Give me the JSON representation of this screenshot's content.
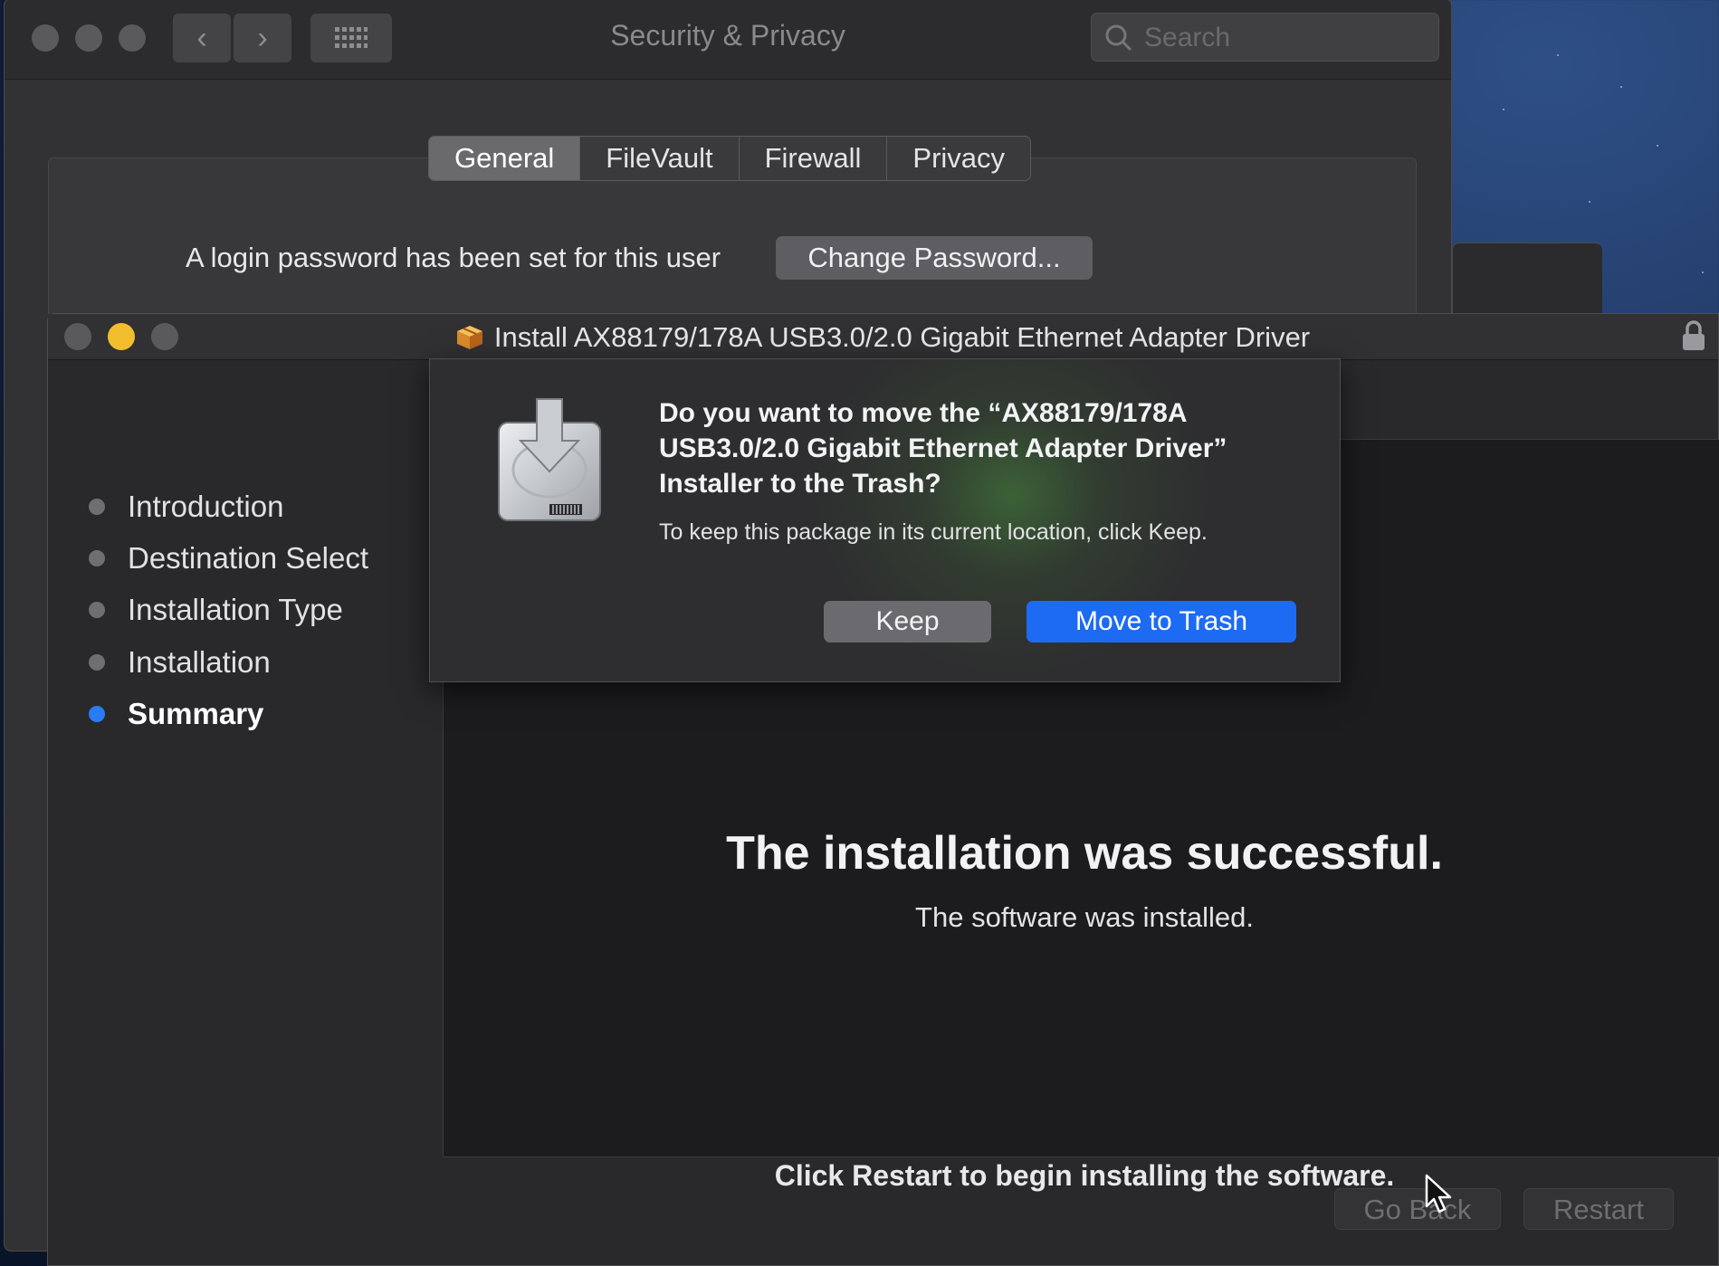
{
  "security_window": {
    "title": "Security & Privacy",
    "search_placeholder": "Search",
    "tabs": [
      {
        "label": "General",
        "active": true
      },
      {
        "label": "FileVault",
        "active": false
      },
      {
        "label": "Firewall",
        "active": false
      },
      {
        "label": "Privacy",
        "active": false
      }
    ],
    "login_text": "A login password has been set for this user",
    "change_password_label": "Change Password..."
  },
  "installer": {
    "title": "Install AX88179/178A USB3.0/2.0 Gigabit Ethernet Adapter Driver",
    "steps": [
      {
        "label": "Introduction",
        "active": false
      },
      {
        "label": "Destination Select",
        "active": false
      },
      {
        "label": "Installation Type",
        "active": false
      },
      {
        "label": "Installation",
        "active": false
      },
      {
        "label": "Summary",
        "active": true
      }
    ],
    "success_title": "The installation was successful.",
    "success_subtitle": "The software was installed.",
    "restart_hint": "Click Restart to begin installing the software.",
    "go_back_label": "Go Back",
    "restart_label": "Restart"
  },
  "dialog": {
    "heading": "Do you want to move the “AX88179/178A USB3.0/2.0 Gigabit Ethernet Adapter Driver” Installer to the Trash?",
    "body": "To keep this package in its current location, click Keep.",
    "keep_label": "Keep",
    "trash_label": "Move to Trash"
  },
  "colors": {
    "accent_blue": "#1d6bf2",
    "active_step_dot": "#2a7cf6",
    "minimize_yellow": "#f2be2d"
  }
}
